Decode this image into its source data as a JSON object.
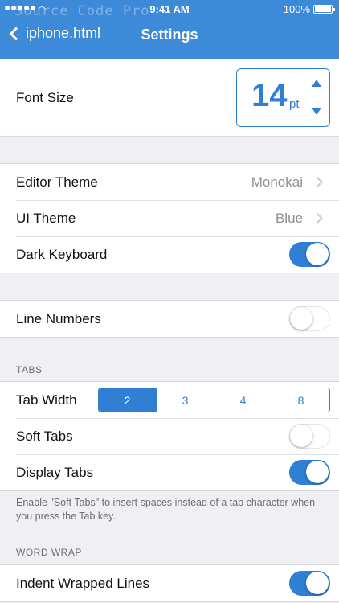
{
  "status": {
    "watermark": "Source Code Pro",
    "time": "9:41 AM",
    "battery": "100%"
  },
  "nav": {
    "back_label": "iphone.html",
    "title": "Settings"
  },
  "font_size": {
    "label": "Font Size",
    "value": "14",
    "unit": "pt"
  },
  "appearance": {
    "editor_theme": {
      "label": "Editor Theme",
      "value": "Monokai"
    },
    "ui_theme": {
      "label": "UI Theme",
      "value": "Blue"
    },
    "dark_keyboard": {
      "label": "Dark Keyboard",
      "on": true
    }
  },
  "line_numbers": {
    "label": "Line Numbers",
    "on": false
  },
  "tabs": {
    "header": "TABS",
    "tab_width": {
      "label": "Tab Width",
      "options": [
        "2",
        "3",
        "4",
        "8"
      ],
      "selected": "2"
    },
    "soft_tabs": {
      "label": "Soft Tabs",
      "on": false
    },
    "display_tabs": {
      "label": "Display Tabs",
      "on": true
    },
    "footer": "Enable \"Soft Tabs\" to insert spaces instead of a tab character when you press the Tab key."
  },
  "word_wrap": {
    "header": "WORD WRAP",
    "indent_wrapped": {
      "label": "Indent Wrapped Lines",
      "on": true
    }
  },
  "colors": {
    "nav_bg": "#3d8ad9",
    "accent": "#2f7fd4",
    "background": "#efeff4"
  }
}
